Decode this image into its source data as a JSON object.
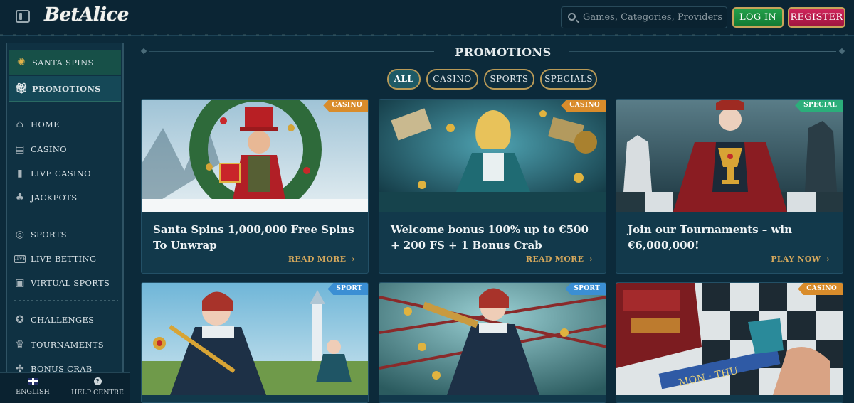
{
  "header": {
    "brand": "BetAlice",
    "search_placeholder": "Games, Categories, Providers",
    "login_label": "LOG IN",
    "register_label": "REGISTER"
  },
  "sidebar": {
    "featured": [
      {
        "label": "Santa Spins",
        "icon": "snowflake-icon"
      },
      {
        "label": "Promotions",
        "icon": "gift-icon"
      }
    ],
    "groups": [
      [
        {
          "label": "Home",
          "icon": "home-icon"
        },
        {
          "label": "Casino",
          "icon": "slot-machine-icon"
        },
        {
          "label": "Live Casino",
          "icon": "cards-icon"
        },
        {
          "label": "Jackpots",
          "icon": "clover-icon"
        }
      ],
      [
        {
          "label": "Sports",
          "icon": "ball-icon"
        },
        {
          "label": "Live Betting",
          "icon": "live-icon"
        },
        {
          "label": "Virtual Sports",
          "icon": "virtual-icon"
        }
      ],
      [
        {
          "label": "Challenges",
          "icon": "medal-icon"
        },
        {
          "label": "Tournaments",
          "icon": "trophy-icon"
        },
        {
          "label": "Bonus Crab",
          "icon": "crab-icon"
        }
      ]
    ],
    "footer": {
      "language": "ENGLISH",
      "help": "HELP CENTRE"
    }
  },
  "main": {
    "title": "PROMOTIONS",
    "filters": [
      "ALL",
      "CASINO",
      "SPORTS",
      "SPECIALS"
    ],
    "active_filter": "ALL",
    "cards": [
      {
        "tag": "CASINO",
        "title": "Santa Spins 1,000,000 Free Spins To Unwrap",
        "cta": "READ MORE"
      },
      {
        "tag": "CASINO",
        "title": "Welcome bonus 100% up to €500 + 200 FS + 1 Bonus Crab",
        "cta": "READ MORE"
      },
      {
        "tag": "SPECIAL",
        "title": "Join our Tournaments – win €6,000,000!",
        "cta": "PLAY NOW"
      },
      {
        "tag": "SPORT",
        "title": "",
        "cta": ""
      },
      {
        "tag": "SPORT",
        "title": "",
        "cta": ""
      },
      {
        "tag": "CASINO",
        "title": "",
        "cta": ""
      }
    ]
  },
  "colors": {
    "background": "#0c2a3a",
    "accent_gold": "#d5a85c",
    "login_green": "#1a8c3f",
    "register_pink": "#c01f50",
    "tag_casino": "#d98c2b",
    "tag_special": "#2bae7a",
    "tag_sport": "#3b8fd4"
  }
}
